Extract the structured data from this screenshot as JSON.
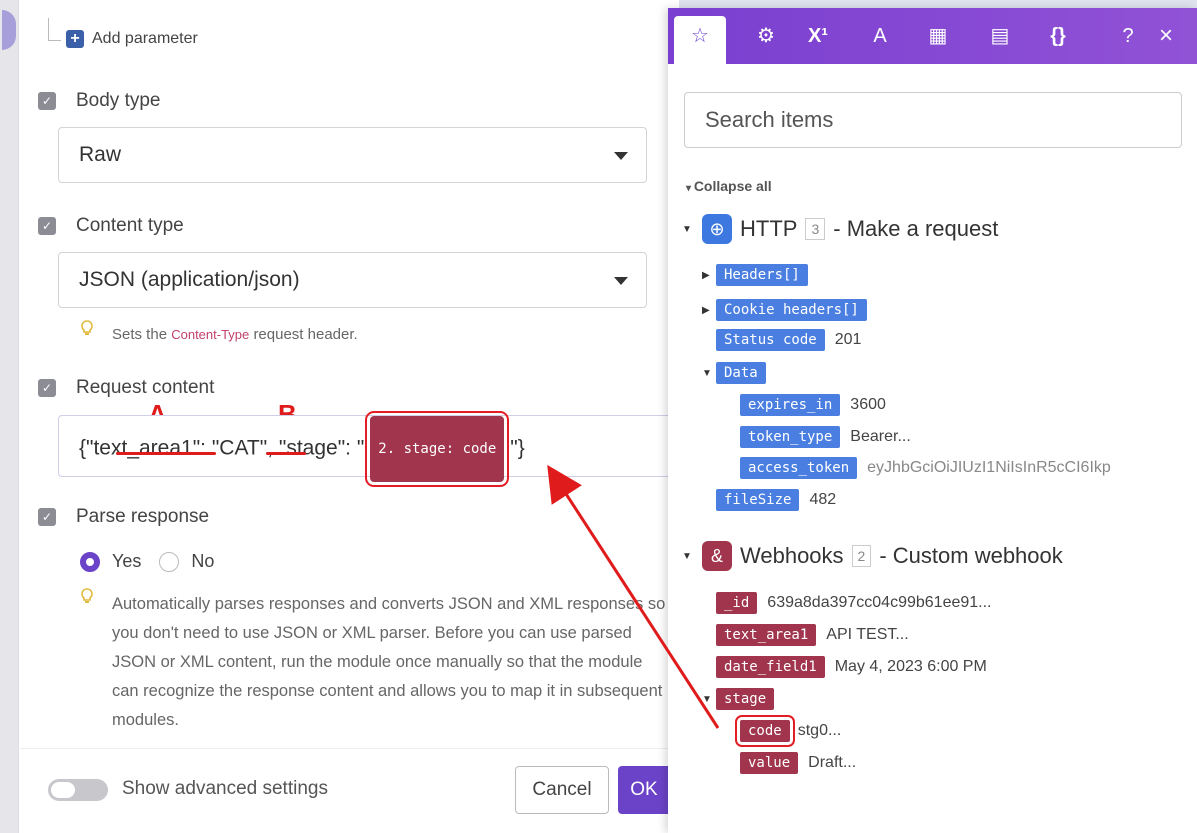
{
  "left": {
    "add_parameter": "Add parameter",
    "body_type": {
      "label": "Body type",
      "value": "Raw"
    },
    "content_type": {
      "label": "Content type",
      "value": "JSON (application/json)",
      "hint_prefix": "Sets the",
      "hint_code": "Content-Type",
      "hint_suffix": "request header."
    },
    "request_content": {
      "label": "Request content",
      "text_part1": "{\"",
      "text_key": "text_area1",
      "text_part2": "\": \"",
      "text_cat": "CAT",
      "text_part3": "\", \"stage\": \"",
      "pill": "2. stage: code",
      "text_end": "\"}"
    },
    "parse_response": {
      "label": "Parse response",
      "yes": "Yes",
      "no": "No",
      "hint": "Automatically parses responses and converts JSON and XML responses so you don't need to use JSON or XML parser. Before you can use parsed JSON or XML content, run the module once manually so that the module can recognize the response content and allows you to map it in subsequent modules."
    },
    "advanced": "Show advanced settings",
    "cancel": "Cancel",
    "ok": "OK"
  },
  "annotations": {
    "a": "A",
    "b": "B"
  },
  "right": {
    "toolbar": [
      "☆",
      "⚙",
      "X¹",
      "A",
      "▦",
      "▤",
      "{}",
      "?",
      "×"
    ],
    "search_placeholder": "Search items",
    "collapse_all": "Collapse all",
    "http": {
      "name": "HTTP",
      "num": "3",
      "title": "- Make a request",
      "headers": "Headers[]",
      "cookie": "Cookie headers[]",
      "status_code": "Status code",
      "status_val": "201",
      "data": "Data",
      "expires_in": "expires_in",
      "expires_val": "3600",
      "token_type": "token_type",
      "token_type_val": "Bearer...",
      "access_token": "access_token",
      "access_token_val": "eyJhbGciOiJIUzI1NiIsInR5cCI6Ikp",
      "filesize": "fileSize",
      "filesize_val": "482"
    },
    "webhooks": {
      "name": "Webhooks",
      "num": "2",
      "title": "- Custom webhook",
      "id": "_id",
      "id_val": "639a8da397cc04c99b61ee91...",
      "text_area1": "text_area1",
      "text_area1_val": "API TEST...",
      "date_field1": "date_field1",
      "date_field1_val": "May 4, 2023 6:00 PM",
      "stage": "stage",
      "code": "code",
      "code_val": "stg0...",
      "value": "value",
      "value_val": "Draft..."
    }
  },
  "colors": {
    "accent": "#6b43c9",
    "http_blue": "#4a7ee0",
    "webhook_wine": "#a0354d",
    "annotation_red": "#e01b1b"
  }
}
